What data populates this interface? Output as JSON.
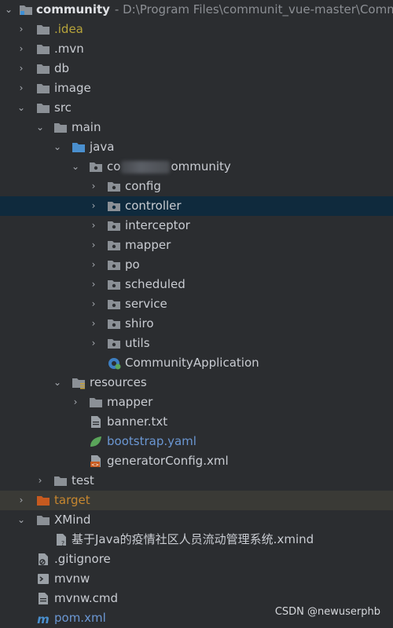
{
  "project": {
    "name": "community",
    "path": "- D:\\Program Files\\communit_vue-master\\Comm"
  },
  "tree": {
    "idea": ".idea",
    "mvn": ".mvn",
    "db": "db",
    "image": "image",
    "src": "src",
    "main": "main",
    "java": "java",
    "pkg_prefix": "co",
    "pkg_suffix": "ommunity",
    "config": "config",
    "controller": "controller",
    "interceptor": "interceptor",
    "mapper": "mapper",
    "po": "po",
    "scheduled": "scheduled",
    "service": "service",
    "shiro": "shiro",
    "utils": "utils",
    "app": "CommunityApplication",
    "resources": "resources",
    "res_mapper": "mapper",
    "banner": "banner.txt",
    "bootstrap": "bootstrap.yaml",
    "generator": "generatorConfig.xml",
    "test": "test",
    "target": "target",
    "xmind": "XMind",
    "xmind_file": "基于Java的疫情社区人员流动管理系统.xmind",
    "gitignore": ".gitignore",
    "mvnw": "mvnw",
    "mvnw_cmd": "mvnw.cmd",
    "pom": "pom.xml"
  },
  "watermark": "CSDN @newuserphb",
  "colors": {
    "background": "#2b2d30",
    "selected_row": "#0f2a3d",
    "excluded_row": "#3a3a36",
    "folder": "#8b9096",
    "source_folder": "#4a8fce",
    "excluded_folder": "#c75a1f"
  }
}
